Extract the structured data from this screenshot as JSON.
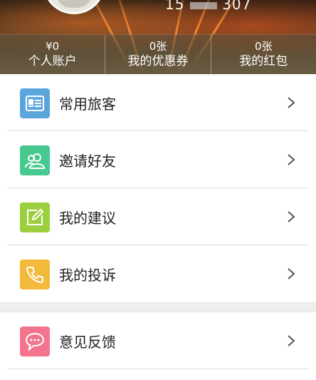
{
  "header": {
    "phone_prefix": "15",
    "phone_suffix": "307"
  },
  "stats": [
    {
      "value": "¥0",
      "label": "个人账户"
    },
    {
      "value": "0张",
      "label": "我的优惠券"
    },
    {
      "value": "0张",
      "label": "我的红包"
    }
  ],
  "menu": {
    "group1": [
      {
        "label": "常用旅客",
        "icon": "contact-card-icon",
        "color": "#5aa6dc"
      },
      {
        "label": "邀请好友",
        "icon": "users-icon",
        "color": "#47c88e"
      },
      {
        "label": "我的建议",
        "icon": "edit-icon",
        "color": "#9ccf3f"
      },
      {
        "label": "我的投诉",
        "icon": "phone-icon",
        "color": "#f3b93a"
      }
    ],
    "group2": [
      {
        "label": "意见反馈",
        "icon": "chat-icon",
        "color": "#f2748d"
      }
    ]
  },
  "colors": {
    "separator": "#dddddd",
    "section_gap": "#efefef"
  }
}
